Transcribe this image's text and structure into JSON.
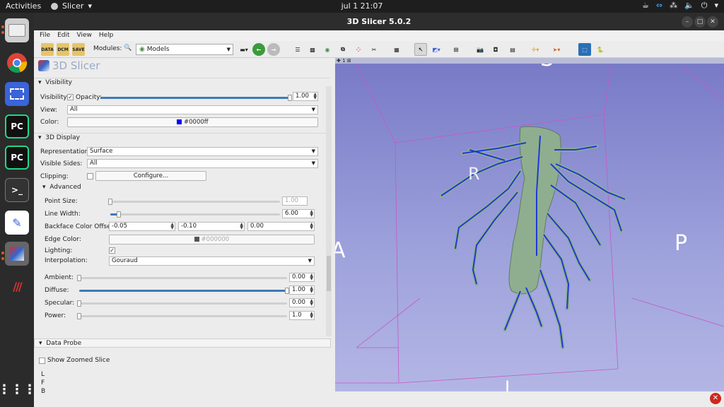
{
  "topbar": {
    "activities": "Activities",
    "app": "Slicer",
    "clock": "jul 1  21:07"
  },
  "window": {
    "title": "3D Slicer 5.0.2"
  },
  "menu": [
    "File",
    "Edit",
    "View",
    "Help"
  ],
  "toolbar": {
    "data_label": "DATA",
    "dcm_label": "DCM",
    "save_label": "SAVE",
    "modules_label": "Modules:",
    "module_value": "Models"
  },
  "panel": {
    "logo_text": "3D Slicer",
    "visibility": {
      "header": "Visibility",
      "visibility_label": "Visibility:",
      "opacity_label": "Opacity:",
      "opacity_value": "1.00",
      "opacity_fraction": 1.0,
      "view_label": "View:",
      "view_value": "All",
      "color_label": "Color:",
      "color_value": "#0000ff"
    },
    "display": {
      "header": "3D Display",
      "representation_label": "Representation:",
      "representation_value": "Surface",
      "sides_label": "Visible Sides:",
      "sides_value": "All",
      "clipping_label": "Clipping:",
      "configure_label": "Configure...",
      "advanced_header": "Advanced",
      "point_size_label": "Point Size:",
      "point_size_value": "1.00",
      "point_size_fraction": 0.0,
      "line_width_label": "Line Width:",
      "line_width_value": "6.00",
      "line_width_fraction": 0.05,
      "backface_label": "Backface Color Offset:",
      "backface_values": [
        "-0.05",
        "-0.10",
        "0.00"
      ],
      "edge_label": "Edge Color:",
      "edge_value": "#000000",
      "lighting_label": "Lighting:",
      "interp_label": "Interpolation:",
      "interp_value": "Gouraud",
      "ambient_label": "Ambient:",
      "ambient_value": "0.00",
      "ambient_fraction": 0.0,
      "diffuse_label": "Diffuse:",
      "diffuse_value": "1.00",
      "diffuse_fraction": 1.0,
      "specular_label": "Specular:",
      "specular_value": "0.00",
      "specular_fraction": 0.0,
      "power_label": "Power:",
      "power_value": "1.0",
      "power_fraction": 0.0
    },
    "probe": {
      "header": "Data Probe",
      "zoom_label": "Show Zoomed Slice",
      "l": "L",
      "f": "F",
      "b": "B"
    }
  },
  "view": {
    "layout_number": "1",
    "orient_s": "S",
    "orient_a": "A",
    "orient_p": "P",
    "orient_r": "R",
    "orient_i": "I"
  },
  "colors": {
    "accent": "#3d7ab8",
    "model_color": "#0000ff",
    "vessel": "#8fae8f"
  }
}
